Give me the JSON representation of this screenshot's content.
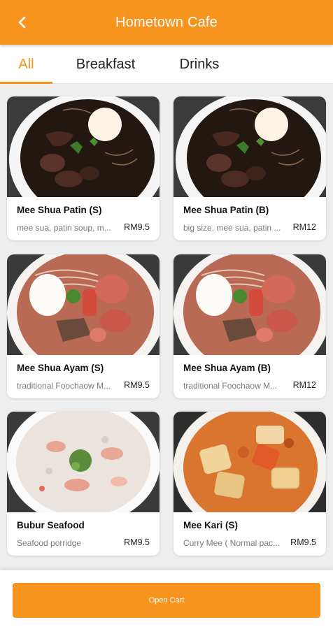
{
  "header": {
    "title": "Hometown Cafe",
    "back_icon": "chevron-left-icon",
    "background_color": "#f7941d"
  },
  "tabs": [
    {
      "label": "All",
      "active": true
    },
    {
      "label": "Breakfast",
      "active": false
    },
    {
      "label": "Drinks",
      "active": false
    }
  ],
  "menu": {
    "items": [
      {
        "name": "Mee Shua Patin (S)",
        "description": "mee sua, patin soup, m...",
        "price": "RM9.5",
        "image": "patin-soup-photo"
      },
      {
        "name": "Mee Shua Patin (B)",
        "description": "big size, mee sua, patin ...",
        "price": "RM12",
        "image": "patin-soup-photo"
      },
      {
        "name": "Mee Shua Ayam (S)",
        "description": "traditional Foochaow M...",
        "price": "RM9.5",
        "image": "chicken-soup-photo"
      },
      {
        "name": "Mee Shua Ayam (B)",
        "description": "traditional Foochaow M...",
        "price": "RM12",
        "image": "chicken-soup-photo"
      },
      {
        "name": "Bubur Seafood",
        "description": "Seafood porridge",
        "price": "RM9.5",
        "image": "seafood-porridge-photo"
      },
      {
        "name": "Mee Kari (S)",
        "description": "Curry Mee ( Normal pac...",
        "price": "RM9.5",
        "image": "curry-mee-photo"
      }
    ]
  },
  "cart": {
    "button_label": "Open Cart"
  },
  "colors": {
    "accent": "#f7941d",
    "background": "#eeeeee"
  }
}
